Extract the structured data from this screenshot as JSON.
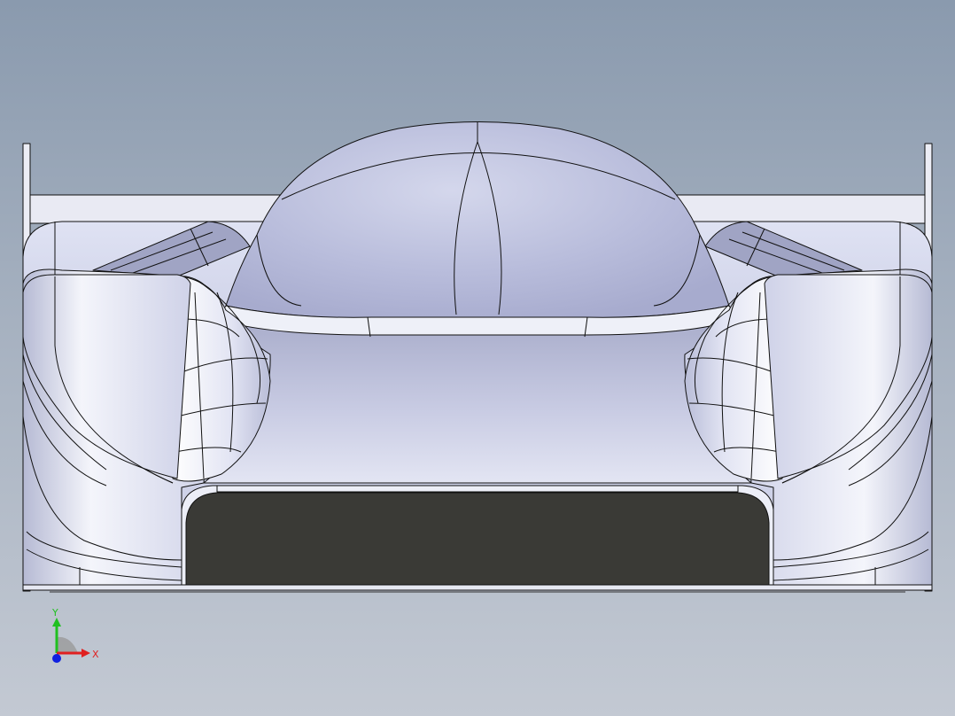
{
  "viewport": {
    "background_top": "#8a9aae",
    "background_bottom": "#c3c9d3"
  },
  "model": {
    "body_color": "#c9cde6",
    "edge_color": "#111111",
    "radiator_color": "#3a3a36"
  },
  "triad": {
    "x_label": "X",
    "y_label": "Y",
    "x_color": "#e02020",
    "y_color": "#20c020",
    "z_color": "#1020e0"
  }
}
